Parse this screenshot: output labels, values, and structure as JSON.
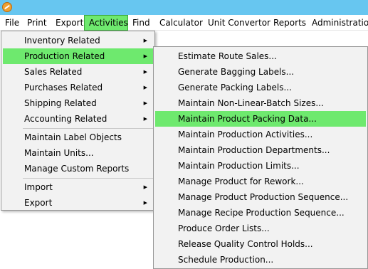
{
  "app": {
    "icon": "app-logo-icon"
  },
  "menubar": {
    "items": [
      {
        "label": "File"
      },
      {
        "label": "Print"
      },
      {
        "label": "Export"
      },
      {
        "label": "Activities"
      },
      {
        "label": "Find"
      },
      {
        "label": "Calculator"
      },
      {
        "label": "Unit Convertor"
      },
      {
        "label": "Reports"
      },
      {
        "label": "Administration"
      }
    ]
  },
  "activities_menu": {
    "items": [
      {
        "label": "Inventory Related"
      },
      {
        "label": "Production Related"
      },
      {
        "label": "Sales Related"
      },
      {
        "label": "Purchases Related"
      },
      {
        "label": "Shipping Related"
      },
      {
        "label": "Accounting Related"
      },
      {
        "label": "Maintain Label Objects"
      },
      {
        "label": "Maintain Units..."
      },
      {
        "label": "Manage Custom Reports"
      },
      {
        "label": "Import"
      },
      {
        "label": "Export"
      }
    ],
    "arrow": "▶"
  },
  "production_menu": {
    "items": [
      {
        "label": "Estimate Route Sales..."
      },
      {
        "label": "Generate Bagging Labels..."
      },
      {
        "label": "Generate Packing Labels..."
      },
      {
        "label": "Maintain Non-Linear-Batch Sizes..."
      },
      {
        "label": "Maintain Product Packing Data..."
      },
      {
        "label": "Maintain Production Activities..."
      },
      {
        "label": "Maintain Production Departments..."
      },
      {
        "label": "Maintain Production Limits..."
      },
      {
        "label": "Manage Product for Rework..."
      },
      {
        "label": "Manage Product Production Sequence..."
      },
      {
        "label": "Manage Recipe Production Sequence..."
      },
      {
        "label": "Produce Order Lists..."
      },
      {
        "label": "Release Quality Control Holds..."
      },
      {
        "label": "Schedule Production..."
      }
    ]
  },
  "colors": {
    "titlebar": "#67c6f0",
    "highlight": "#6ee96e",
    "menu_bg": "#f2f2f2"
  }
}
